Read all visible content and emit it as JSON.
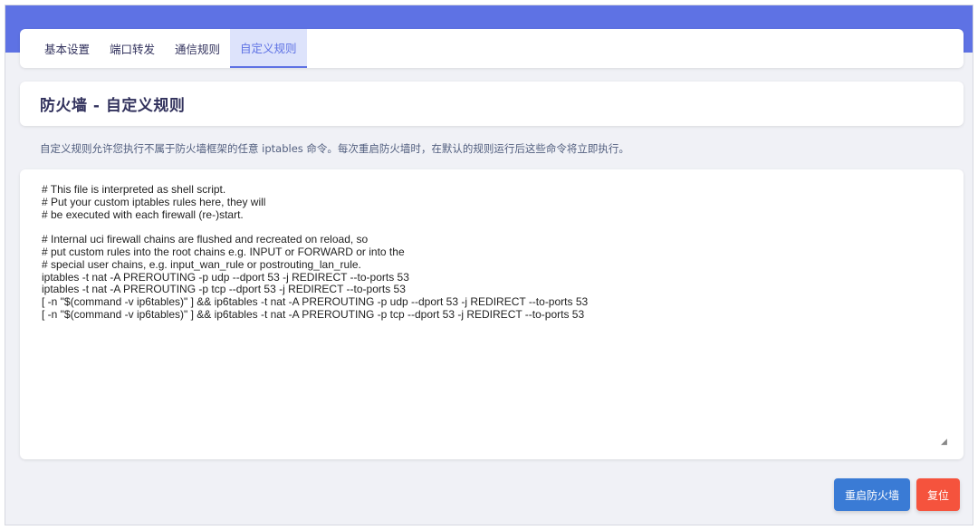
{
  "tabs": [
    {
      "label": "基本设置"
    },
    {
      "label": "端口转发"
    },
    {
      "label": "通信规则"
    },
    {
      "label": "自定义规则"
    }
  ],
  "page_title": "防火墙 - 自定义规则",
  "description": "自定义规则允许您执行不属于防火墙框架的任意 iptables 命令。每次重启防火墙时，在默认的规则运行后这些命令将立即执行。",
  "editor_content": "# This file is interpreted as shell script.\n# Put your custom iptables rules here, they will\n# be executed with each firewall (re-)start.\n\n# Internal uci firewall chains are flushed and recreated on reload, so\n# put custom rules into the root chains e.g. INPUT or FORWARD or into the\n# special user chains, e.g. input_wan_rule or postrouting_lan_rule.\niptables -t nat -A PREROUTING -p udp --dport 53 -j REDIRECT --to-ports 53\niptables -t nat -A PREROUTING -p tcp --dport 53 -j REDIRECT --to-ports 53\n[ -n \"$(command -v ip6tables)\" ] && ip6tables -t nat -A PREROUTING -p udp --dport 53 -j REDIRECT --to-ports 53\n[ -n \"$(command -v ip6tables)\" ] && ip6tables -t nat -A PREROUTING -p tcp --dport 53 -j REDIRECT --to-ports 53",
  "buttons": {
    "restart": "重启防火墙",
    "reset": "复位"
  },
  "colors": {
    "accent": "#5e72e4",
    "restart_button": "#3a7bd5",
    "reset_button": "#f5533d"
  }
}
